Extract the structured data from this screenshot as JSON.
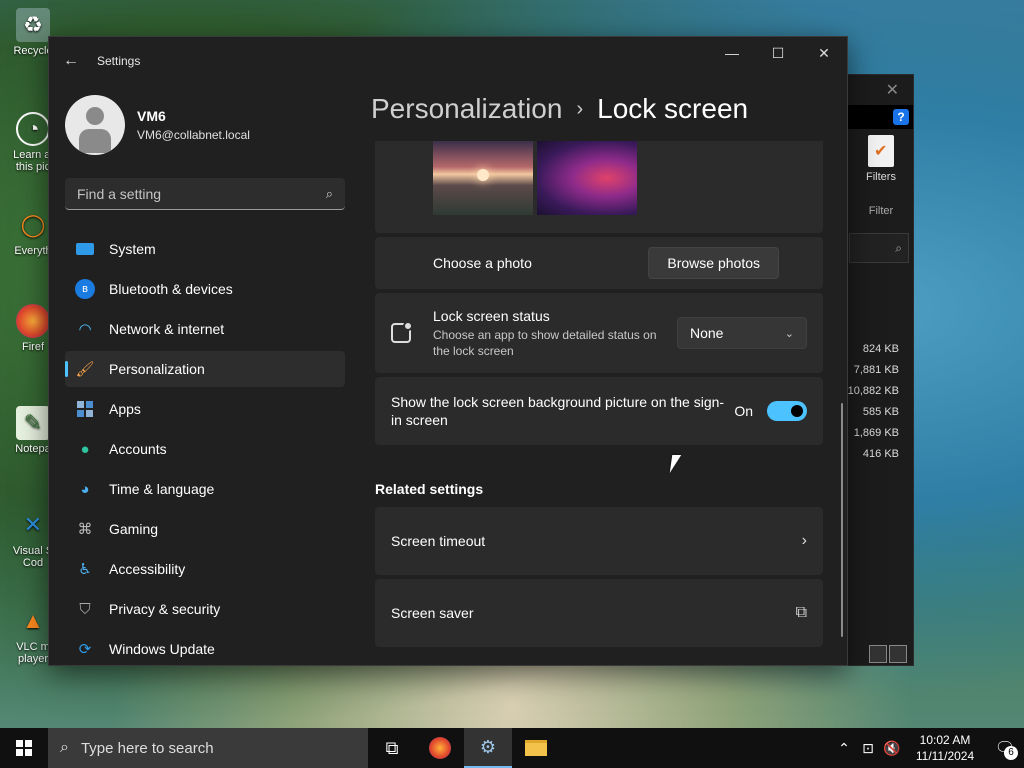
{
  "desktop": {
    "icons": [
      {
        "label": "Recycle",
        "icon": "recycle-bin-icon"
      },
      {
        "label": "Learn al this pic",
        "icon": "camera-icon"
      },
      {
        "label": "Everyth",
        "icon": "search-app-icon"
      },
      {
        "label": "Firef",
        "icon": "firefox-icon"
      },
      {
        "label": "Notepa",
        "icon": "notepad-icon"
      },
      {
        "label": "Visual S Cod",
        "icon": "vscode-icon"
      },
      {
        "label": "VLC m player",
        "icon": "vlc-icon"
      }
    ]
  },
  "explorer": {
    "filters_label": "Filters",
    "filter_group": "Filter",
    "search_glyph": "⌕",
    "sizes": [
      "824 KB",
      "7,881 KB",
      "10,882 KB",
      "585 KB",
      "",
      "1,869 KB",
      "416 KB"
    ]
  },
  "settings": {
    "app_title": "Settings",
    "user": {
      "name": "VM6",
      "email": "VM6@collabnet.local"
    },
    "search_placeholder": "Find a setting",
    "nav": [
      {
        "label": "System",
        "icon": "system-icon"
      },
      {
        "label": "Bluetooth & devices",
        "icon": "bluetooth-icon"
      },
      {
        "label": "Network & internet",
        "icon": "wifi-icon"
      },
      {
        "label": "Personalization",
        "icon": "brush-icon",
        "active": true
      },
      {
        "label": "Apps",
        "icon": "apps-icon"
      },
      {
        "label": "Accounts",
        "icon": "accounts-icon"
      },
      {
        "label": "Time & language",
        "icon": "globe-clock-icon"
      },
      {
        "label": "Gaming",
        "icon": "gamepad-icon"
      },
      {
        "label": "Accessibility",
        "icon": "accessibility-icon"
      },
      {
        "label": "Privacy & security",
        "icon": "shield-icon"
      },
      {
        "label": "Windows Update",
        "icon": "update-icon"
      }
    ],
    "breadcrumb": {
      "parent": "Personalization",
      "separator": "›",
      "current": "Lock screen"
    },
    "choose_photo": {
      "label": "Choose a photo",
      "button": "Browse photos"
    },
    "lock_status": {
      "title": "Lock screen status",
      "description": "Choose an app to show detailed status on the lock screen",
      "selected": "None"
    },
    "signin_bg": {
      "label": "Show the lock screen background picture on the sign-in screen",
      "state": "On",
      "value": true
    },
    "related": {
      "heading": "Related settings",
      "items": [
        {
          "label": "Screen timeout",
          "icon": "chevron-right-icon",
          "glyph": "›"
        },
        {
          "label": "Screen saver",
          "icon": "external-link-icon",
          "glyph": "⧉"
        }
      ]
    }
  },
  "taskbar": {
    "search_text": "Type here to search",
    "time": "10:02 AM",
    "date": "11/11/2024",
    "notification_count": "6"
  },
  "colors": {
    "accent": "#4cc2ff",
    "window_bg": "#202020",
    "card_bg": "#2b2b2b",
    "taskbar_bg": "#101010"
  }
}
